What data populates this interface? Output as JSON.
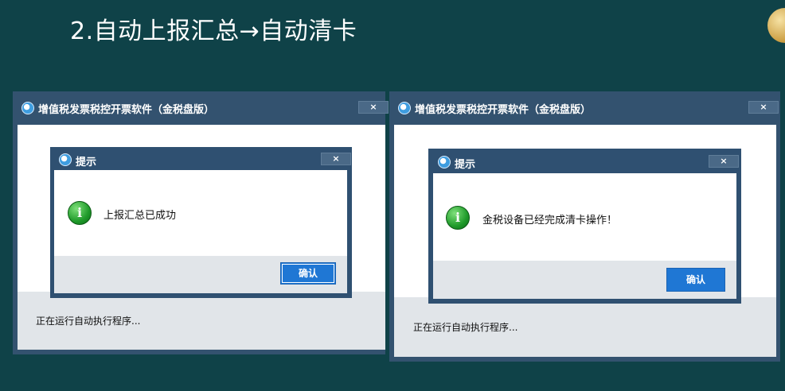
{
  "slide": {
    "title": "2.自动上报汇总→自动清卡"
  },
  "windows": [
    {
      "title": "增值税发票税控开票软件（金税盘版）",
      "close": "×",
      "status": "正在运行自动执行程序...",
      "dialog": {
        "title": "提示",
        "close": "×",
        "message": "上报汇总已成功",
        "ok": "确认"
      }
    },
    {
      "title": "增值税发票税控开票软件（金税盘版）",
      "close": "×",
      "status": "正在运行自动执行程序...",
      "dialog": {
        "title": "提示",
        "close": "×",
        "message": "金税设备已经完成清卡操作！",
        "ok": "确认"
      }
    }
  ],
  "info_icon_glyph": "i"
}
